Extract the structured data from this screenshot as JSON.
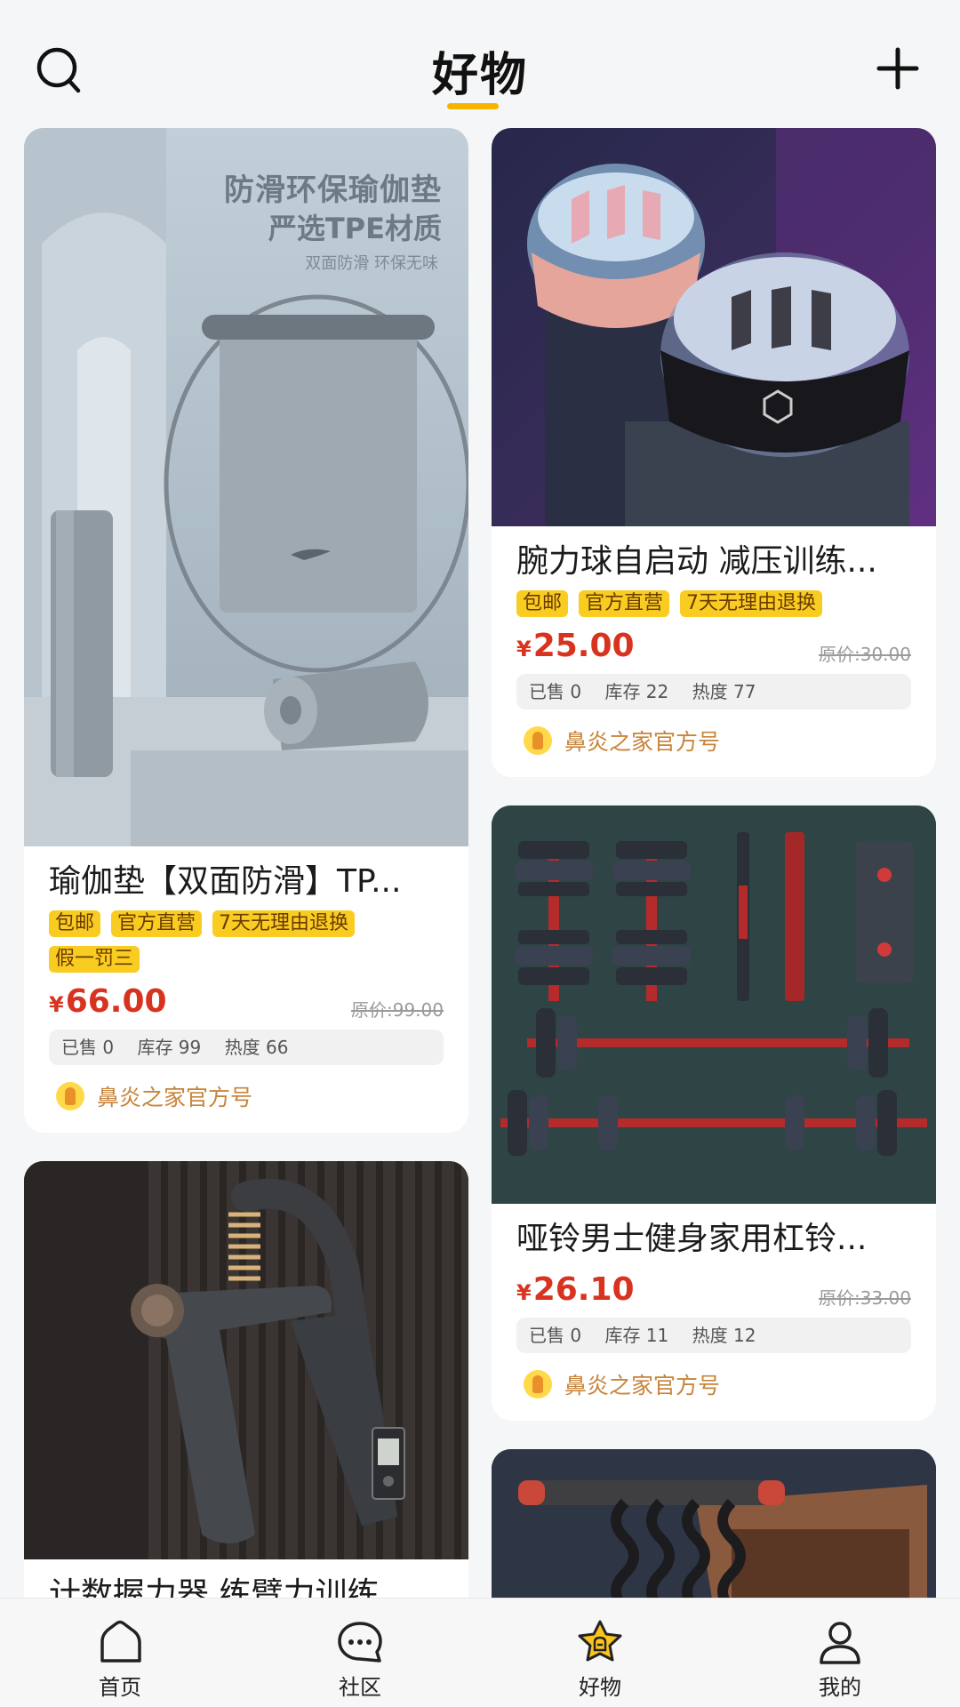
{
  "header": {
    "title": "好物"
  },
  "products": [
    {
      "name": "瑜伽垫【双面防滑】TP...",
      "image_text": {
        "line1": "防滑环保瑜伽垫",
        "line2": "严选TPE材质",
        "line3": "双面防滑 环保无味"
      },
      "tags": [
        "包邮",
        "官方直营",
        "7天无理由退换",
        "假一罚三"
      ],
      "currency": "¥",
      "price": "66.00",
      "original_price": "原价:99.00",
      "sold": "已售 0",
      "stock": "库存 99",
      "heat": "热度 66",
      "shop": "鼻炎之家官方号"
    },
    {
      "name": "腕力球自启动 减压训练...",
      "tags": [
        "包邮",
        "官方直营",
        "7天无理由退换"
      ],
      "currency": "¥",
      "price": "25.00",
      "original_price": "原价:30.00",
      "sold": "已售 0",
      "stock": "库存 22",
      "heat": "热度 77",
      "shop": "鼻炎之家官方号"
    },
    {
      "name": "哑铃男士健身家用杠铃...",
      "tags": [],
      "currency": "¥",
      "price": "26.10",
      "original_price": "原价:33.00",
      "sold": "已售 0",
      "stock": "库存 11",
      "heat": "热度 12",
      "shop": "鼻炎之家官方号"
    },
    {
      "name": "计数握力器 练臂力训练 ..."
    }
  ],
  "tabbar": {
    "items": [
      {
        "label": "首页",
        "icon": "home-icon"
      },
      {
        "label": "社区",
        "icon": "chat-bubble-icon"
      },
      {
        "label": "好物",
        "icon": "star-shop-icon",
        "active": true
      },
      {
        "label": "我的",
        "icon": "user-icon"
      }
    ]
  },
  "colors": {
    "accent": "#f4b400",
    "price": "#d8331f",
    "tag_bg": "#f9cc22",
    "shop_text": "#c8843a"
  }
}
